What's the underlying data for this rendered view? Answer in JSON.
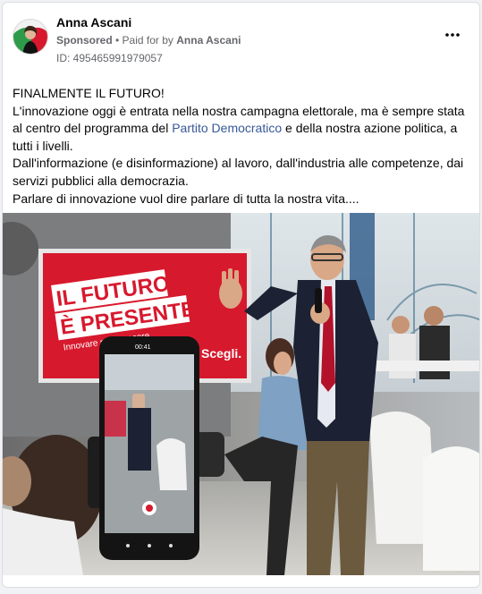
{
  "post": {
    "author_name": "Anna Ascani",
    "sponsored_label": "Sponsored",
    "separator": " • ",
    "paid_for_prefix": "Paid for by ",
    "paid_for_name": "Anna Ascani",
    "ad_id": "ID: 495465991979057",
    "more_icon": "more-horizontal-icon"
  },
  "body": {
    "line1": "FINALMENTE IL FUTURO!",
    "line2_before_link": "L'innovazione oggi è entrata nella nostra campagna elettorale, ma è sempre stata al centro del programma del ",
    "line2_link": "Partito Democratico",
    "line2_after_link": " e della nostra azione politica, a tutti i livelli.",
    "line3": "Dall'informazione (e disinformazione) al lavoro, dall'industria alle competenze, dai servizi pubblici alla democrazia.",
    "line4": "Parlare di innovazione vuol dire parlare di tutta la nostra vita...."
  },
  "photo": {
    "banner_line1": "IL FUTURO",
    "banner_line2": "È PRESENTE!",
    "banner_tag": "Innovare per crescere",
    "banner_brand": "Scegli.",
    "phone_time": "00:41",
    "colors": {
      "banner_red": "#d7192d",
      "jacket": "#1c2233",
      "tie": "#b3122a"
    }
  }
}
